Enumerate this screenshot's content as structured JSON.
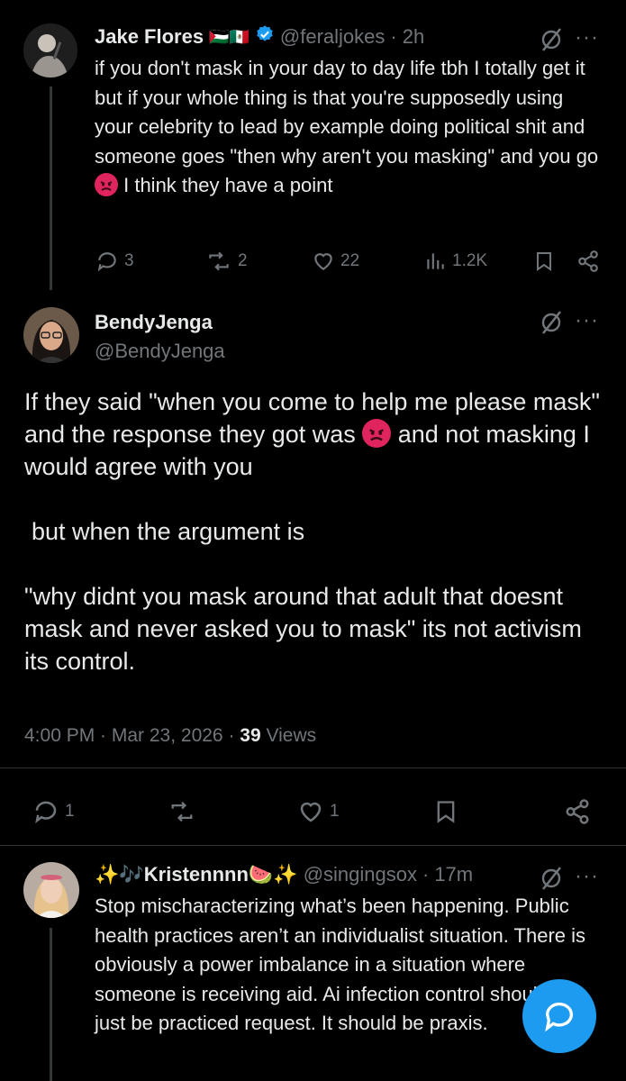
{
  "tweet1": {
    "name": "Jake Flores",
    "flags": "🇵🇸🇲🇽",
    "handle": "@feraljokes",
    "time": "2h",
    "text_a": "if you don't mask in your day to day life tbh I totally get it but if your whole thing is that you're supposedly using your celebrity to lead by example doing political shit and someone goes \"then why aren't you masking\" and you go ",
    "text_b": " I think they have a point",
    "replies": "3",
    "reposts": "2",
    "likes": "22",
    "views": "1.2K"
  },
  "tweet2": {
    "name": "BendyJenga",
    "handle": "@BendyJenga",
    "para1_a": "If they said \"when you come to help me please mask\" and the response they got was ",
    "para1_b": " and not masking I would agree with you",
    "para2": "but when the argument is",
    "para3": "\"why didnt you mask around that adult that doesnt mask and never asked you to mask\" its not activism its control.",
    "timestamp": "4:00 PM · Mar 23, 2026 · ",
    "views_count": "39",
    "views_label": " Views",
    "replies": "1",
    "likes": "1"
  },
  "tweet3": {
    "name": "✨🎶Kristennnn🍉✨",
    "handle": "@singingsox",
    "time": "17m",
    "text": "Stop mischaracterizing what’s been happening. Public health practices aren’t an individualist situation. There is obviously a power imbalance in a situation where someone is receiving aid. Ai infection control shouldn’t just be practiced request. It should be praxis."
  },
  "colors": {
    "accent": "#1d9bf0",
    "muted": "#71767b",
    "text": "#e7e9ea",
    "angry_emoji": "#e0245e"
  }
}
